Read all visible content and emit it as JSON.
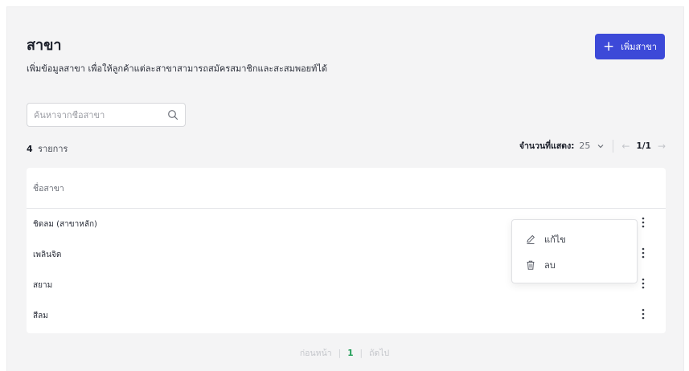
{
  "header": {
    "title": "สาขา",
    "subtitle": "เพิ่มข้อมูลสาขา เพื่อให้ลูกค้าแต่ละสาขาสามารถสมัครสมาชิกและสะสมพอยท์ได้",
    "add_button_label": "เพิ่มสาขา",
    "add_button_icon": "plus-icon",
    "accent_color": "#3c49d8"
  },
  "search": {
    "placeholder": "ค้นหาจากชื่อสาขา",
    "value": "",
    "icon": "search-icon"
  },
  "summary": {
    "count": "4",
    "count_label": "รายการ"
  },
  "pagination_top": {
    "page_size_label": "จำนวนที่แสดง:",
    "page_size": "25",
    "page_info": "1/1"
  },
  "table": {
    "header": "ชื่อสาขา",
    "rows": [
      {
        "name": "ชิดลม (สาขาหลัก)"
      },
      {
        "name": "เพลินจิต"
      },
      {
        "name": "สยาม"
      },
      {
        "name": "สีลม"
      }
    ]
  },
  "row_menu": {
    "edit_label": "แก้ไข",
    "edit_icon": "pencil-icon",
    "delete_label": "ลบ",
    "delete_icon": "trash-icon"
  },
  "pagination_bottom": {
    "prev_label": "ก่อนหน้า",
    "current": "1",
    "next_label": "ถัดไป",
    "current_color": "#1f9d55"
  }
}
